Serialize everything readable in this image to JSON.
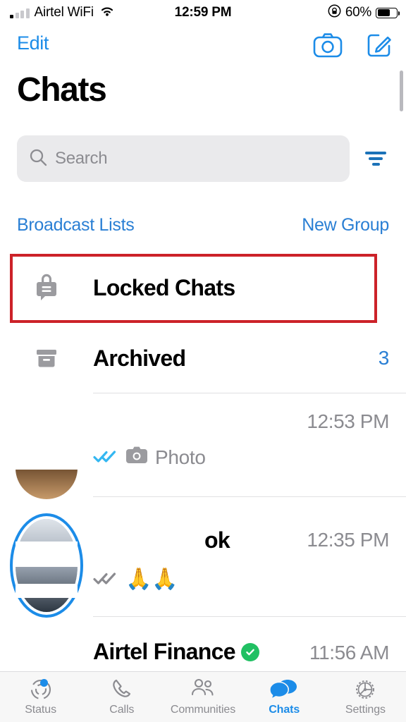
{
  "status_bar": {
    "carrier": "Airtel WiFi",
    "time": "12:59 PM",
    "battery_percent": "60%",
    "signal_icon": "signal-bars-icon",
    "wifi_icon": "wifi-icon",
    "rotation_lock_icon": "rotation-lock-icon",
    "battery_icon": "battery-icon"
  },
  "nav": {
    "edit_label": "Edit",
    "camera_icon": "camera-icon",
    "compose_icon": "compose-icon"
  },
  "header": {
    "title": "Chats"
  },
  "search": {
    "placeholder": "Search",
    "value": "",
    "search_icon": "search-icon",
    "filter_icon": "filter-icon"
  },
  "actions": {
    "broadcast_lists": "Broadcast Lists",
    "new_group": "New Group"
  },
  "system_rows": [
    {
      "label": "Locked Chats",
      "icon": "lock-chat-icon",
      "count": "",
      "highlighted": true
    },
    {
      "label": "Archived",
      "icon": "archive-box-icon",
      "count": "3",
      "highlighted": false
    }
  ],
  "chats": [
    {
      "name": "",
      "time": "12:53 PM",
      "preview": "Photo",
      "preview_icon": "camera-icon",
      "receipt": "double-check-read-icon",
      "receipt_color": "#34b7f1",
      "verified": false,
      "status_ring": false
    },
    {
      "name": "ok",
      "time": "12:35 PM",
      "preview": "🙏🙏",
      "preview_icon": "",
      "receipt": "double-check-delivered-icon",
      "receipt_color": "#8b8b90",
      "verified": false,
      "status_ring": true
    },
    {
      "name": "Airtel Finance",
      "time": "11:56 AM",
      "preview": "",
      "preview_icon": "",
      "receipt": "",
      "receipt_color": "",
      "verified": true,
      "status_ring": false
    }
  ],
  "tabs": [
    {
      "label": "Status",
      "icon": "status-rings-icon",
      "active": false,
      "badge": true
    },
    {
      "label": "Calls",
      "icon": "phone-icon",
      "active": false,
      "badge": false
    },
    {
      "label": "Communities",
      "icon": "communities-icon",
      "active": false,
      "badge": false
    },
    {
      "label": "Chats",
      "icon": "chat-bubbles-icon",
      "active": true,
      "badge": false
    },
    {
      "label": "Settings",
      "icon": "gear-icon",
      "active": false,
      "badge": false
    }
  ],
  "annotation": {
    "color": "#cc2229",
    "target": "Locked Chats"
  },
  "colors": {
    "accent_blue": "#1c8ce8",
    "link_blue": "#2a7fd4",
    "verified_green": "#21c063",
    "read_receipt_blue": "#34b7f1",
    "secondary_text": "#8b8b90"
  }
}
